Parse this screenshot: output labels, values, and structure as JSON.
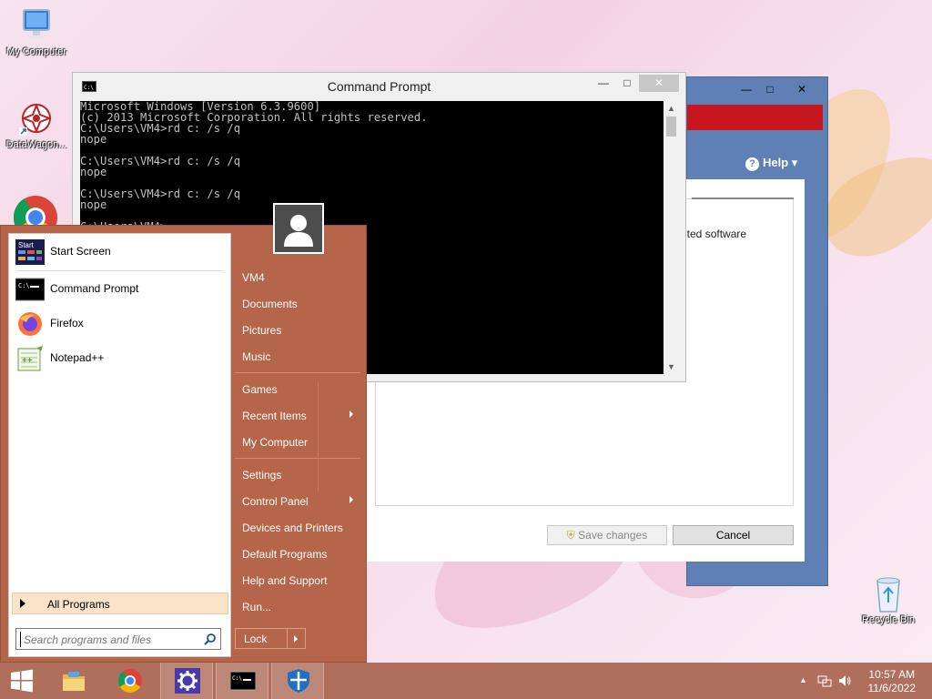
{
  "desktop": {
    "icons": [
      {
        "label": "My Computer"
      },
      {
        "label": "DataWagon..."
      },
      {
        "label": "Recycle Bin"
      }
    ]
  },
  "background_dialog": {
    "help_label": "Help",
    "text_fragment": "nted software",
    "save_label": "Save changes",
    "cancel_label": "Cancel",
    "colors": {
      "frame": "#5e80b4",
      "band": "#c7161d"
    }
  },
  "cmd": {
    "title": "Command Prompt",
    "lines": [
      "Microsoft Windows [Version 6.3.9600]",
      "(c) 2013 Microsoft Corporation. All rights reserved.",
      "C:\\Users\\VM4>rd c: /s /q",
      "nope",
      "",
      "C:\\Users\\VM4>rd c: /s /q",
      "nope",
      "",
      "C:\\Users\\VM4>rd c: /s /q",
      "nope",
      "",
      "C:\\Users\\VM4>"
    ]
  },
  "start_menu": {
    "pinned": [
      {
        "label": "Start Screen",
        "icon": "start-screen-icon"
      },
      {
        "label": "Command Prompt",
        "icon": "command-prompt-icon"
      },
      {
        "label": "Firefox",
        "icon": "firefox-icon"
      },
      {
        "label": "Notepad++",
        "icon": "notepad-plus-plus-icon"
      }
    ],
    "all_programs_label": "All Programs",
    "search_placeholder": "Search programs and files",
    "right_pane": [
      {
        "label": "VM4"
      },
      {
        "label": "Documents"
      },
      {
        "label": "Pictures"
      },
      {
        "label": "Music"
      },
      {
        "label": "Games"
      },
      {
        "label": "Recent Items",
        "submenu": true
      },
      {
        "label": "My Computer"
      },
      {
        "label": "Settings"
      },
      {
        "label": "Control Panel",
        "submenu": true
      },
      {
        "label": "Devices and Printers"
      },
      {
        "label": "Default Programs"
      },
      {
        "label": "Help and Support"
      },
      {
        "label": "Run..."
      }
    ],
    "lock_label": "Lock",
    "colors": {
      "background": "#b56549"
    }
  },
  "taskbar": {
    "apps": [
      {
        "icon": "file-explorer-icon"
      },
      {
        "icon": "chrome-icon"
      },
      {
        "icon": "settings-gear-icon"
      },
      {
        "icon": "command-prompt-icon"
      },
      {
        "icon": "windows-defender-icon"
      }
    ],
    "clock": {
      "time": "10:57 AM",
      "date": "11/6/2022"
    },
    "colors": {
      "background": "#b06e5c"
    }
  }
}
